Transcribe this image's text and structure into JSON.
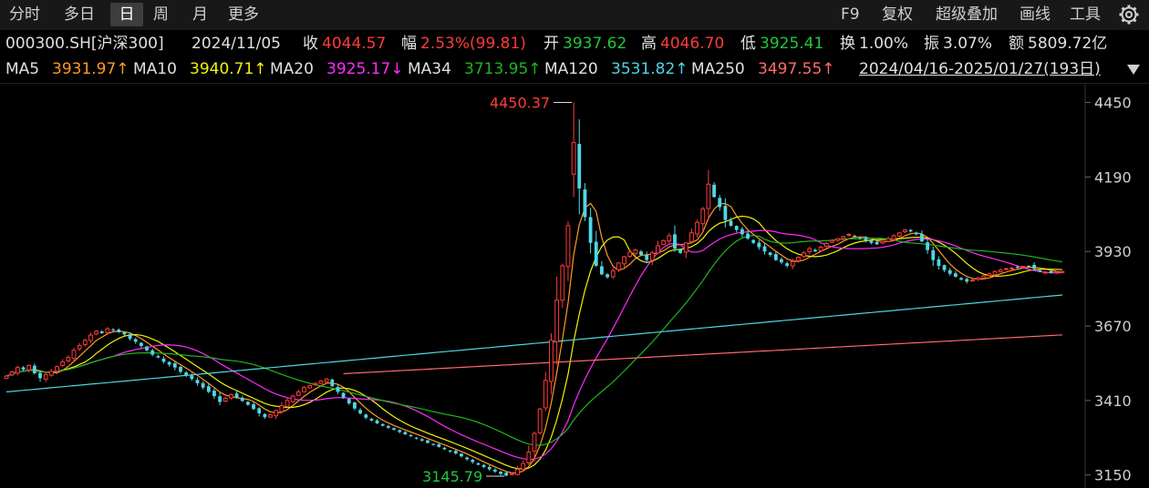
{
  "toolbar": {
    "tabs": [
      "分时",
      "多日",
      "日",
      "周",
      "月",
      "更多"
    ],
    "active_tab": "日",
    "tools": [
      "F9",
      "复权",
      "超级叠加",
      "画线",
      "工具"
    ]
  },
  "quote": {
    "symbol": "000300.SH[沪深300]",
    "date": "2024/11/05",
    "close_label": "收",
    "close": "4044.57",
    "change_label": "幅",
    "change": "2.53%(99.81)",
    "open_label": "开",
    "open": "3937.62",
    "high_label": "高",
    "high": "4046.70",
    "low_label": "低",
    "low": "3925.41",
    "turnover_label": "换",
    "turnover": "1.00%",
    "amplitude_label": "振",
    "amplitude": "3.07%",
    "amount_label": "额",
    "amount": "5809.72亿"
  },
  "ma": [
    {
      "name": "MA5",
      "value": "3931.97↑",
      "color": "#ff9a1f"
    },
    {
      "name": "MA10",
      "value": "3940.71↑",
      "color": "#f2f20a"
    },
    {
      "name": "MA20",
      "value": "3925.17↓",
      "color": "#ff2bff"
    },
    {
      "name": "MA34",
      "value": "3713.95↑",
      "color": "#1fb51f"
    },
    {
      "name": "MA120",
      "value": "3531.82↑",
      "color": "#4fd6e6"
    },
    {
      "name": "MA250",
      "value": "3497.55↑",
      "color": "#ff6b6b"
    }
  ],
  "range": "2024/04/16-2025/01/27(193日)",
  "colors": {
    "up": "#ff3b3b",
    "down": "#4fd6e6",
    "label_high": "#ff3b3b",
    "label_low": "#22c63d"
  },
  "chart_data": {
    "type": "candlestick",
    "ylim": [
      3130,
      4490
    ],
    "yticks": [
      "4450",
      "4190",
      "3930",
      "3670",
      "3410",
      "3150"
    ],
    "high_label": "4450.37",
    "low_label": "3145.79",
    "close": [
      3495,
      3510,
      3525,
      3518,
      3532,
      3505,
      3488,
      3500,
      3512,
      3528,
      3545,
      3560,
      3585,
      3602,
      3620,
      3638,
      3652,
      3645,
      3660,
      3655,
      3648,
      3640,
      3625,
      3615,
      3600,
      3585,
      3570,
      3560,
      3545,
      3535,
      3525,
      3510,
      3498,
      3485,
      3470,
      3455,
      3440,
      3425,
      3405,
      3418,
      3430,
      3420,
      3408,
      3395,
      3380,
      3365,
      3352,
      3360,
      3375,
      3392,
      3410,
      3425,
      3440,
      3455,
      3462,
      3470,
      3478,
      3485,
      3460,
      3440,
      3420,
      3400,
      3382,
      3365,
      3350,
      3340,
      3330,
      3322,
      3315,
      3308,
      3300,
      3292,
      3285,
      3278,
      3270,
      3262,
      3255,
      3248,
      3240,
      3232,
      3225,
      3215,
      3205,
      3195,
      3186,
      3178,
      3170,
      3162,
      3154,
      3148,
      3155,
      3170,
      3190,
      3230,
      3295,
      3380,
      3480,
      3620,
      3760,
      3880,
      4020,
      4310,
      4150,
      4050,
      3960,
      3880,
      3850,
      3840,
      3862,
      3890,
      3912,
      3928,
      3935,
      3918,
      3900,
      3925,
      3950,
      3968,
      3985,
      3940,
      3925,
      3960,
      3995,
      4032,
      4078,
      4165,
      4120,
      4085,
      4040,
      4020,
      4005,
      3990,
      3975,
      3960,
      3945,
      3930,
      3918,
      3900,
      3892,
      3880,
      3895,
      3910,
      3925,
      3940,
      3930,
      3945,
      3958,
      3968,
      3975,
      3982,
      3990,
      3982,
      3975,
      3968,
      3960,
      3955,
      3965,
      3975,
      3985,
      3995,
      4005,
      4000,
      3990,
      3965,
      3935,
      3900,
      3880,
      3865,
      3852,
      3842,
      3832,
      3825,
      3830,
      3838,
      3845,
      3852,
      3860,
      3865,
      3870,
      3872,
      3875,
      3878,
      3880,
      3870,
      3860,
      3858,
      3855,
      3858,
      3860
    ],
    "ma_colors": [
      "#ff9a1f",
      "#f2f20a",
      "#ff2bff",
      "#1fb51f",
      "#4fd6e6",
      "#ff6b6b"
    ],
    "ma_periods": [
      5,
      10,
      20,
      34,
      120,
      250
    ]
  }
}
